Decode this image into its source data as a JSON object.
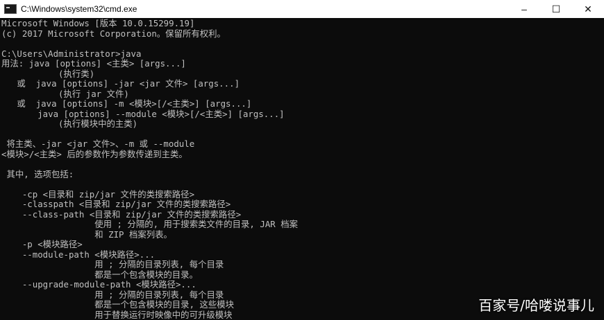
{
  "window": {
    "title": "C:\\Windows\\system32\\cmd.exe",
    "minimize_icon": "–",
    "maximize_icon": "☐",
    "close_icon": "✕"
  },
  "console": {
    "lines": [
      "Microsoft Windows [版本 10.0.15299.19]",
      "(c) 2017 Microsoft Corporation。保留所有权利。",
      "",
      "C:\\Users\\Administrator>java",
      "用法: java [options] <主类> [args...]",
      "           (执行类)",
      "   或  java [options] -jar <jar 文件> [args...]",
      "           (执行 jar 文件)",
      "   或  java [options] -m <模块>[/<主类>] [args...]",
      "       java [options] --module <模块>[/<主类>] [args...]",
      "           (执行模块中的主类)",
      "",
      " 将主类、-jar <jar 文件>、-m 或 --module",
      "<模块>/<主类> 后的参数作为参数传递到主类。",
      "",
      " 其中, 选项包括:",
      "",
      "    -cp <目录和 zip/jar 文件的类搜索路径>",
      "    -classpath <目录和 zip/jar 文件的类搜索路径>",
      "    --class-path <目录和 zip/jar 文件的类搜索路径>",
      "                  使用 ; 分隔的, 用于搜索类文件的目录, JAR 档案",
      "                  和 ZIP 档案列表。",
      "    -p <模块路径>",
      "    --module-path <模块路径>...",
      "                  用 ; 分隔的目录列表, 每个目录",
      "                  都是一个包含模块的目录。",
      "    --upgrade-module-path <模块路径>...",
      "                  用 ; 分隔的目录列表, 每个目录",
      "                  都是一个包含模块的目录, 这些模块",
      "                  用于替换运行时映像中的可升级模块"
    ]
  },
  "watermark": "百家号/哈喽说事儿"
}
